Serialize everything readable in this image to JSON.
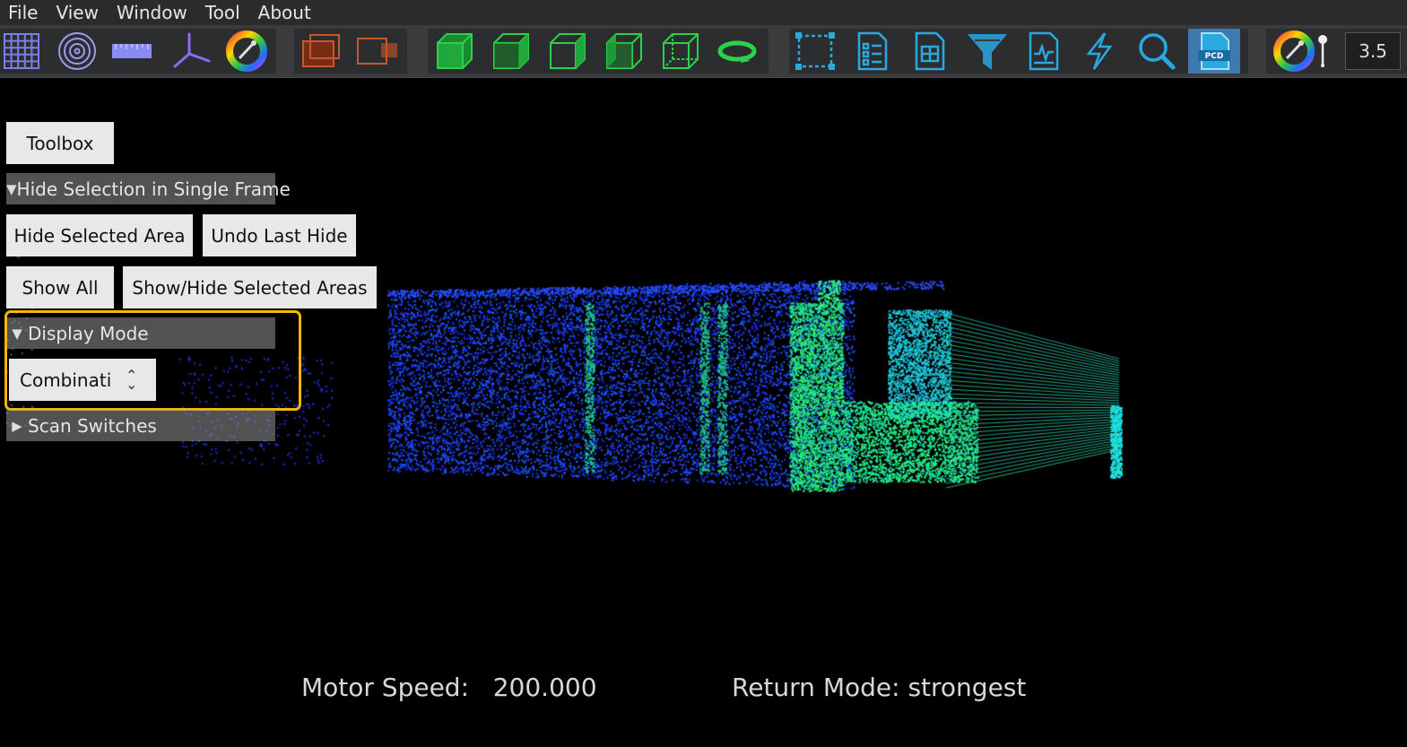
{
  "menu": [
    "File",
    "View",
    "Window",
    "Tool",
    "About"
  ],
  "toolbar": {
    "zoom_value": "3.5",
    "icons": [
      "grid-icon",
      "rings-icon",
      "ruler-icon",
      "axes-icon",
      "color-wheel-icon",
      "frame-box-icon",
      "frame-projection-icon",
      "cube-front-icon",
      "cube-side-icon",
      "cube-top-icon",
      "cube-left-icon",
      "cube-corner-icon",
      "rotate-icon",
      "select-box-icon",
      "list-icon",
      "table-icon",
      "filter-icon",
      "waveform-icon",
      "lightning-icon",
      "search-icon",
      "pcd-icon",
      "color-wheel-icon",
      "point-size-icon"
    ]
  },
  "panel": {
    "toolbox_label": "Toolbox",
    "hide_section_label": "Hide Selection in Single Frame",
    "hide_selected_label": "Hide Selected Area",
    "undo_hide_label": "Undo Last Hide",
    "show_all_label": "Show All",
    "show_hide_areas_label": "Show/Hide Selected Areas",
    "display_mode_label": "Display Mode",
    "display_mode_value": "Combinati",
    "scan_switches_label": "Scan Switches"
  },
  "status": {
    "motor_speed_label": "Motor Speed:",
    "motor_speed_value": "200.000",
    "return_mode_label": "Return Mode:",
    "return_mode_value": "strongest"
  },
  "colors": {
    "highlight": "#f5b800",
    "accent_blue": "#2aa8e0",
    "cube_green": "#1fa83a",
    "frame_orange": "#c8582a"
  }
}
